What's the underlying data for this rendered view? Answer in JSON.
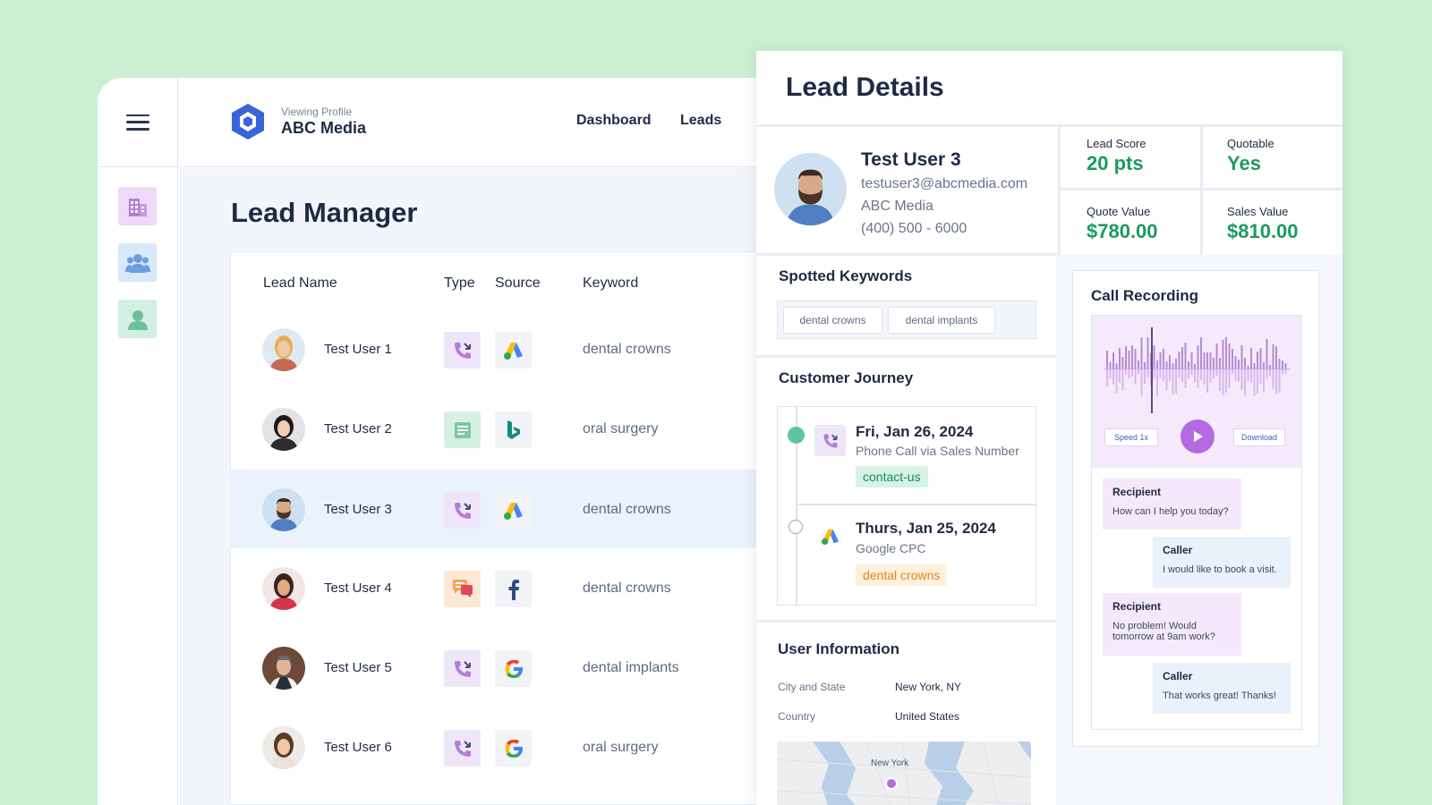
{
  "header": {
    "profile_caption": "Viewing Profile",
    "profile_name": "ABC Media",
    "nav": [
      "Dashboard",
      "Leads"
    ]
  },
  "sidebar": {
    "items": [
      {
        "icon": "building-icon",
        "color": "#efd9f7"
      },
      {
        "icon": "team-icon",
        "color": "#d8e9fb"
      },
      {
        "icon": "user-icon",
        "color": "#d3efe3"
      }
    ]
  },
  "lead_manager": {
    "title": "Lead Manager",
    "columns": [
      "Lead Name",
      "Type",
      "Source",
      "Keyword"
    ],
    "rows": [
      {
        "name": "Test User 1",
        "type": "phone-call-icon",
        "source": "google-ads-icon",
        "keyword": "dental crowns"
      },
      {
        "name": "Test User 2",
        "type": "form-icon",
        "source": "bing-icon",
        "keyword": "oral surgery"
      },
      {
        "name": "Test User 3",
        "type": "phone-call-icon",
        "source": "google-ads-icon",
        "keyword": "dental crowns",
        "selected": true
      },
      {
        "name": "Test User 4",
        "type": "chat-icon",
        "source": "facebook-icon",
        "keyword": "dental crowns"
      },
      {
        "name": "Test User 5",
        "type": "phone-call-icon",
        "source": "google-icon",
        "keyword": "dental implants"
      },
      {
        "name": "Test User 6",
        "type": "phone-call-icon",
        "source": "google-icon",
        "keyword": "oral surgery"
      }
    ]
  },
  "lead_details": {
    "title": "Lead Details",
    "contact": {
      "name": "Test User 3",
      "email": "testuser3@abcmedia.com",
      "company": "ABC Media",
      "phone": "(400) 500 - 6000"
    },
    "stats": {
      "lead_score_label": "Lead Score",
      "lead_score": "20 pts",
      "quotable_label": "Quotable",
      "quotable": "Yes",
      "quote_value_label": "Quote Value",
      "quote_value": "$780.00",
      "sales_value_label": "Sales Value",
      "sales_value": "$810.00"
    },
    "keywords_title": "Spotted Keywords",
    "keywords": [
      "dental crowns",
      "dental implants"
    ],
    "journey_title": "Customer Journey",
    "journey": [
      {
        "date": "Fri, Jan 26, 2024",
        "sub": "Phone Call via Sales Number",
        "tag": "contact-us",
        "icon": "phone-call-icon"
      },
      {
        "date": "Thurs, Jan 25, 2024",
        "sub": "Google CPC",
        "tag": "dental crowns",
        "icon": "google-ads-icon"
      }
    ],
    "user_info_title": "User Information",
    "user_info": {
      "city_label": "City and State",
      "city": "New York, NY",
      "country_label": "Country",
      "country": "United States",
      "map_label": "New York"
    }
  },
  "call_recording": {
    "title": "Call Recording",
    "speed": "Speed 1x",
    "download": "Download",
    "transcript": [
      {
        "who": "Recipient",
        "text": "How can I help you today?"
      },
      {
        "who": "Caller",
        "text": "I would like to book a visit."
      },
      {
        "who": "Recipient",
        "text": "No problem! Would tomorrow at 9am work?"
      },
      {
        "who": "Caller",
        "text": "That works great! Thanks!"
      }
    ]
  },
  "colors": {
    "accent_green": "#1a9a63",
    "brand_blue": "#3a63d8",
    "recording_purple": "#b36ae2"
  }
}
